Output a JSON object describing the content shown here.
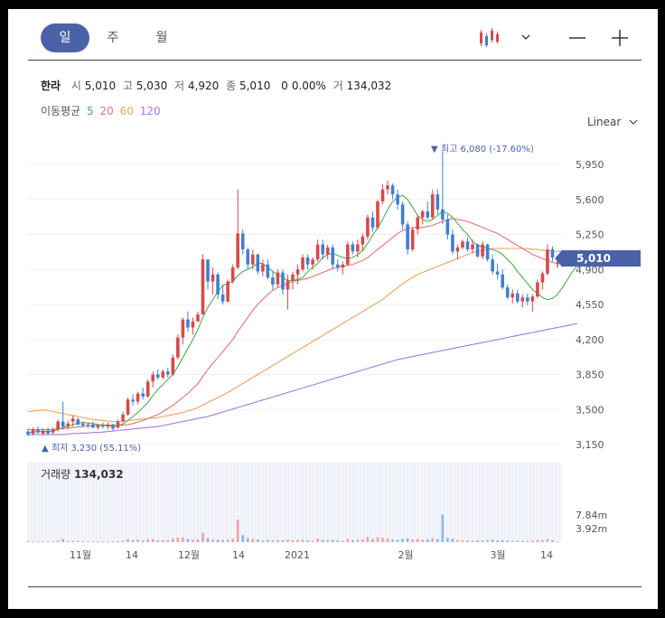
{
  "periods": [
    "일",
    "주",
    "월"
  ],
  "active_period": "일",
  "stock": {
    "name": "한라",
    "open_label": "시",
    "open": "5,010",
    "high_label": "고",
    "high": "5,030",
    "low_label": "저",
    "low": "4,920",
    "close_label": "종",
    "close": "5,010",
    "change": "0",
    "change_pct": "0.00%",
    "volume_label": "거",
    "volume": "134,032"
  },
  "ma": {
    "label": "이동평균",
    "periods": [
      {
        "value": "5",
        "color": "#4caf50"
      },
      {
        "value": "20",
        "color": "#e57373"
      },
      {
        "value": "60",
        "color": "#f0a15c"
      },
      {
        "value": "120",
        "color": "#a877e0"
      }
    ]
  },
  "scale_mode": "Linear",
  "annotations": {
    "high": "최고 6,080 (-17.60%)",
    "low": "최저 3,230 (55.11%)"
  },
  "current_price_tag": "5,010",
  "volume_panel": {
    "label": "거래량",
    "value": "134,032"
  },
  "chart_data": {
    "type": "candlestick",
    "price_axis": {
      "ticks": [
        "5,950",
        "5,600",
        "5,250",
        "4,900",
        "4,550",
        "4,200",
        "3,850",
        "3,500",
        "3,150"
      ],
      "range": [
        3150,
        6200
      ]
    },
    "volume_axis": {
      "ticks": [
        "7.84m",
        "3.92m"
      ],
      "range": [
        0,
        9000000
      ]
    },
    "x_ticks": [
      "11월",
      "14",
      "12월",
      "14",
      "2021",
      "2월",
      "3월",
      "14"
    ],
    "colors": {
      "up": "#d84a4a",
      "down": "#3f7fd4",
      "ma5": "#4caf50",
      "ma20": "#e57373",
      "ma60": "#f0a15c",
      "ma120": "#a877e0"
    },
    "candles": [
      {
        "o": 3280,
        "h": 3310,
        "l": 3230,
        "c": 3250,
        "v": 300000
      },
      {
        "o": 3260,
        "h": 3320,
        "l": 3240,
        "c": 3300,
        "v": 250000
      },
      {
        "o": 3300,
        "h": 3330,
        "l": 3260,
        "c": 3270,
        "v": 220000
      },
      {
        "o": 3260,
        "h": 3310,
        "l": 3240,
        "c": 3290,
        "v": 200000
      },
      {
        "o": 3290,
        "h": 3320,
        "l": 3250,
        "c": 3260,
        "v": 180000
      },
      {
        "o": 3270,
        "h": 3320,
        "l": 3250,
        "c": 3300,
        "v": 190000
      },
      {
        "o": 3300,
        "h": 3400,
        "l": 3280,
        "c": 3380,
        "v": 400000
      },
      {
        "o": 3380,
        "h": 3580,
        "l": 3300,
        "c": 3330,
        "v": 900000
      },
      {
        "o": 3330,
        "h": 3390,
        "l": 3300,
        "c": 3360,
        "v": 350000
      },
      {
        "o": 3380,
        "h": 3440,
        "l": 3330,
        "c": 3410,
        "v": 400000
      },
      {
        "o": 3400,
        "h": 3420,
        "l": 3340,
        "c": 3350,
        "v": 300000
      },
      {
        "o": 3360,
        "h": 3380,
        "l": 3320,
        "c": 3340,
        "v": 250000
      },
      {
        "o": 3340,
        "h": 3370,
        "l": 3310,
        "c": 3350,
        "v": 200000
      },
      {
        "o": 3350,
        "h": 3380,
        "l": 3310,
        "c": 3320,
        "v": 220000
      },
      {
        "o": 3320,
        "h": 3360,
        "l": 3300,
        "c": 3340,
        "v": 180000
      },
      {
        "o": 3340,
        "h": 3370,
        "l": 3310,
        "c": 3330,
        "v": 170000
      },
      {
        "o": 3330,
        "h": 3370,
        "l": 3300,
        "c": 3350,
        "v": 200000
      },
      {
        "o": 3350,
        "h": 3360,
        "l": 3290,
        "c": 3310,
        "v": 190000
      },
      {
        "o": 3320,
        "h": 3400,
        "l": 3310,
        "c": 3380,
        "v": 300000
      },
      {
        "o": 3380,
        "h": 3480,
        "l": 3370,
        "c": 3450,
        "v": 400000
      },
      {
        "o": 3450,
        "h": 3620,
        "l": 3440,
        "c": 3600,
        "v": 900000
      },
      {
        "o": 3600,
        "h": 3650,
        "l": 3540,
        "c": 3580,
        "v": 600000
      },
      {
        "o": 3580,
        "h": 3680,
        "l": 3550,
        "c": 3660,
        "v": 700000
      },
      {
        "o": 3660,
        "h": 3720,
        "l": 3600,
        "c": 3630,
        "v": 500000
      },
      {
        "o": 3630,
        "h": 3800,
        "l": 3620,
        "c": 3780,
        "v": 800000
      },
      {
        "o": 3780,
        "h": 3880,
        "l": 3720,
        "c": 3850,
        "v": 900000
      },
      {
        "o": 3850,
        "h": 3900,
        "l": 3800,
        "c": 3820,
        "v": 500000
      },
      {
        "o": 3820,
        "h": 3900,
        "l": 3800,
        "c": 3880,
        "v": 600000
      },
      {
        "o": 3880,
        "h": 3920,
        "l": 3820,
        "c": 3850,
        "v": 500000
      },
      {
        "o": 3850,
        "h": 4050,
        "l": 3840,
        "c": 4020,
        "v": 1100000
      },
      {
        "o": 4020,
        "h": 4250,
        "l": 4000,
        "c": 4220,
        "v": 1300000
      },
      {
        "o": 4220,
        "h": 4420,
        "l": 4150,
        "c": 4400,
        "v": 1400000
      },
      {
        "o": 4400,
        "h": 4480,
        "l": 4280,
        "c": 4320,
        "v": 900000
      },
      {
        "o": 4320,
        "h": 4420,
        "l": 4250,
        "c": 4380,
        "v": 700000
      },
      {
        "o": 4380,
        "h": 4480,
        "l": 4380,
        "c": 4450,
        "v": 800000
      },
      {
        "o": 4450,
        "h": 5050,
        "l": 4450,
        "c": 5000,
        "v": 2700000
      },
      {
        "o": 5000,
        "h": 5000,
        "l": 4700,
        "c": 4780,
        "v": 1200000
      },
      {
        "o": 4780,
        "h": 4920,
        "l": 4650,
        "c": 4850,
        "v": 800000
      },
      {
        "o": 4850,
        "h": 4870,
        "l": 4600,
        "c": 4650,
        "v": 700000
      },
      {
        "o": 4650,
        "h": 4750,
        "l": 4550,
        "c": 4580,
        "v": 600000
      },
      {
        "o": 4580,
        "h": 4800,
        "l": 4570,
        "c": 4780,
        "v": 700000
      },
      {
        "o": 4780,
        "h": 4950,
        "l": 4760,
        "c": 4920,
        "v": 900000
      },
      {
        "o": 4920,
        "h": 5700,
        "l": 4900,
        "c": 5260,
        "v": 6500000
      },
      {
        "o": 5260,
        "h": 5300,
        "l": 5050,
        "c": 5100,
        "v": 2000000
      },
      {
        "o": 5100,
        "h": 5120,
        "l": 4900,
        "c": 4950,
        "v": 1200000
      },
      {
        "o": 4950,
        "h": 5100,
        "l": 4900,
        "c": 5050,
        "v": 900000
      },
      {
        "o": 5050,
        "h": 5060,
        "l": 4850,
        "c": 4880,
        "v": 700000
      },
      {
        "o": 4880,
        "h": 5000,
        "l": 4830,
        "c": 4950,
        "v": 500000
      },
      {
        "o": 4950,
        "h": 5000,
        "l": 4800,
        "c": 4820,
        "v": 600000
      },
      {
        "o": 4820,
        "h": 4880,
        "l": 4700,
        "c": 4750,
        "v": 500000
      },
      {
        "o": 4750,
        "h": 4900,
        "l": 4720,
        "c": 4870,
        "v": 600000
      },
      {
        "o": 4870,
        "h": 4900,
        "l": 4650,
        "c": 4700,
        "v": 500000
      },
      {
        "o": 4700,
        "h": 4850,
        "l": 4500,
        "c": 4790,
        "v": 700000
      },
      {
        "o": 4790,
        "h": 4880,
        "l": 4700,
        "c": 4850,
        "v": 500000
      },
      {
        "o": 4850,
        "h": 4950,
        "l": 4750,
        "c": 4900,
        "v": 600000
      },
      {
        "o": 4900,
        "h": 5050,
        "l": 4880,
        "c": 5020,
        "v": 700000
      },
      {
        "o": 5020,
        "h": 5050,
        "l": 4900,
        "c": 4950,
        "v": 500000
      },
      {
        "o": 4950,
        "h": 5020,
        "l": 4900,
        "c": 5000,
        "v": 400000
      },
      {
        "o": 5000,
        "h": 5200,
        "l": 4980,
        "c": 5150,
        "v": 1000000
      },
      {
        "o": 5150,
        "h": 5200,
        "l": 5000,
        "c": 5050,
        "v": 700000
      },
      {
        "o": 5050,
        "h": 5150,
        "l": 5000,
        "c": 5120,
        "v": 600000
      },
      {
        "o": 5120,
        "h": 5150,
        "l": 4900,
        "c": 4950,
        "v": 700000
      },
      {
        "o": 4950,
        "h": 5000,
        "l": 4880,
        "c": 4920,
        "v": 500000
      },
      {
        "o": 4920,
        "h": 4980,
        "l": 4850,
        "c": 4950,
        "v": 400000
      },
      {
        "o": 4950,
        "h": 5180,
        "l": 4940,
        "c": 5150,
        "v": 900000
      },
      {
        "o": 5150,
        "h": 5180,
        "l": 5050,
        "c": 5080,
        "v": 600000
      },
      {
        "o": 5080,
        "h": 5200,
        "l": 5020,
        "c": 5150,
        "v": 700000
      },
      {
        "o": 5150,
        "h": 5260,
        "l": 5080,
        "c": 5230,
        "v": 800000
      },
      {
        "o": 5230,
        "h": 5450,
        "l": 5200,
        "c": 5420,
        "v": 1500000
      },
      {
        "o": 5420,
        "h": 5480,
        "l": 5280,
        "c": 5320,
        "v": 900000
      },
      {
        "o": 5320,
        "h": 5600,
        "l": 5300,
        "c": 5580,
        "v": 1400000
      },
      {
        "o": 5580,
        "h": 5750,
        "l": 5550,
        "c": 5700,
        "v": 1200000
      },
      {
        "o": 5700,
        "h": 5790,
        "l": 5650,
        "c": 5740,
        "v": 1000000
      },
      {
        "o": 5740,
        "h": 5760,
        "l": 5600,
        "c": 5650,
        "v": 800000
      },
      {
        "o": 5650,
        "h": 5700,
        "l": 5500,
        "c": 5550,
        "v": 700000
      },
      {
        "o": 5550,
        "h": 5580,
        "l": 5300,
        "c": 5350,
        "v": 900000
      },
      {
        "o": 5350,
        "h": 5380,
        "l": 5050,
        "c": 5100,
        "v": 1100000
      },
      {
        "o": 5100,
        "h": 5320,
        "l": 5080,
        "c": 5300,
        "v": 800000
      },
      {
        "o": 5300,
        "h": 5450,
        "l": 5250,
        "c": 5420,
        "v": 900000
      },
      {
        "o": 5420,
        "h": 5500,
        "l": 5350,
        "c": 5480,
        "v": 700000
      },
      {
        "o": 5480,
        "h": 5580,
        "l": 5400,
        "c": 5420,
        "v": 800000
      },
      {
        "o": 5420,
        "h": 5700,
        "l": 5400,
        "c": 5650,
        "v": 1200000
      },
      {
        "o": 5650,
        "h": 5700,
        "l": 5450,
        "c": 5500,
        "v": 900000
      },
      {
        "o": 5500,
        "h": 6080,
        "l": 5350,
        "c": 5400,
        "v": 8000000
      },
      {
        "o": 5400,
        "h": 5450,
        "l": 5200,
        "c": 5250,
        "v": 1200000
      },
      {
        "o": 5250,
        "h": 5300,
        "l": 5050,
        "c": 5080,
        "v": 1000000
      },
      {
        "o": 5080,
        "h": 5150,
        "l": 5000,
        "c": 5120,
        "v": 600000
      },
      {
        "o": 5120,
        "h": 5200,
        "l": 5100,
        "c": 5180,
        "v": 500000
      },
      {
        "o": 5180,
        "h": 5220,
        "l": 5080,
        "c": 5100,
        "v": 500000
      },
      {
        "o": 5100,
        "h": 5200,
        "l": 5060,
        "c": 5150,
        "v": 400000
      },
      {
        "o": 5150,
        "h": 5160,
        "l": 5020,
        "c": 5030,
        "v": 500000
      },
      {
        "o": 5030,
        "h": 5180,
        "l": 5000,
        "c": 5150,
        "v": 500000
      },
      {
        "o": 5150,
        "h": 5160,
        "l": 4980,
        "c": 5000,
        "v": 600000
      },
      {
        "o": 5000,
        "h": 5050,
        "l": 4850,
        "c": 4880,
        "v": 700000
      },
      {
        "o": 4880,
        "h": 4960,
        "l": 4800,
        "c": 4850,
        "v": 500000
      },
      {
        "o": 4850,
        "h": 4900,
        "l": 4700,
        "c": 4720,
        "v": 600000
      },
      {
        "o": 4720,
        "h": 4750,
        "l": 4600,
        "c": 4620,
        "v": 500000
      },
      {
        "o": 4620,
        "h": 4700,
        "l": 4560,
        "c": 4660,
        "v": 400000
      },
      {
        "o": 4660,
        "h": 4700,
        "l": 4560,
        "c": 4580,
        "v": 400000
      },
      {
        "o": 4580,
        "h": 4650,
        "l": 4520,
        "c": 4620,
        "v": 300000
      },
      {
        "o": 4620,
        "h": 4660,
        "l": 4540,
        "c": 4580,
        "v": 300000
      },
      {
        "o": 4580,
        "h": 4650,
        "l": 4480,
        "c": 4630,
        "v": 400000
      },
      {
        "o": 4630,
        "h": 4800,
        "l": 4610,
        "c": 4770,
        "v": 600000
      },
      {
        "o": 4770,
        "h": 4880,
        "l": 4700,
        "c": 4860,
        "v": 600000
      },
      {
        "o": 4860,
        "h": 5150,
        "l": 4840,
        "c": 5100,
        "v": 900000
      },
      {
        "o": 5100,
        "h": 5130,
        "l": 4980,
        "c": 5020,
        "v": 600000
      },
      {
        "o": 5010,
        "h": 5030,
        "l": 4920,
        "c": 5010,
        "v": 134032
      }
    ],
    "ma5": [
      3270,
      3275,
      3280,
      3280,
      3280,
      3285,
      3300,
      3320,
      3335,
      3350,
      3365,
      3370,
      3365,
      3360,
      3350,
      3345,
      3340,
      3330,
      3340,
      3355,
      3390,
      3430,
      3470,
      3520,
      3570,
      3640,
      3700,
      3750,
      3800,
      3850,
      3930,
      4020,
      4110,
      4200,
      4300,
      4420,
      4520,
      4600,
      4680,
      4740,
      4760,
      4780,
      4840,
      4880,
      4900,
      4930,
      4960,
      4960,
      4920,
      4880,
      4850,
      4820,
      4790,
      4790,
      4800,
      4820,
      4880,
      4920,
      4960,
      5020,
      5050,
      5060,
      5040,
      5020,
      5010,
      5020,
      5050,
      5090,
      5160,
      5240,
      5320,
      5400,
      5500,
      5580,
      5620,
      5640,
      5600,
      5520,
      5440,
      5400,
      5380,
      5400,
      5440,
      5480,
      5460,
      5420,
      5360,
      5300,
      5250,
      5180,
      5140,
      5130,
      5110,
      5100,
      5080,
      5050,
      5000,
      4950,
      4880,
      4820,
      4760,
      4700,
      4660,
      4620,
      4600,
      4610,
      4650,
      4720,
      4800,
      4880,
      4940
    ],
    "ma20": [
      3300,
      3300,
      3300,
      3300,
      3300,
      3300,
      3305,
      3310,
      3315,
      3320,
      3325,
      3330,
      3335,
      3340,
      3340,
      3345,
      3345,
      3340,
      3340,
      3345,
      3350,
      3360,
      3375,
      3390,
      3410,
      3430,
      3450,
      3480,
      3510,
      3540,
      3580,
      3620,
      3660,
      3710,
      3760,
      3830,
      3900,
      3960,
      4020,
      4080,
      4140,
      4200,
      4280,
      4350,
      4420,
      4490,
      4550,
      4600,
      4650,
      4690,
      4720,
      4740,
      4760,
      4780,
      4790,
      4800,
      4810,
      4830,
      4850,
      4870,
      4890,
      4910,
      4920,
      4930,
      4940,
      4950,
      4970,
      4990,
      5020,
      5060,
      5100,
      5140,
      5180,
      5220,
      5260,
      5290,
      5310,
      5320,
      5320,
      5320,
      5330,
      5340,
      5360,
      5380,
      5400,
      5410,
      5400,
      5390,
      5380,
      5360,
      5340,
      5320,
      5300,
      5280,
      5260,
      5230,
      5200,
      5170,
      5140,
      5110,
      5080,
      5050,
      5030,
      5010,
      4990,
      4970,
      4960,
      4950,
      4950,
      4960,
      4970
    ],
    "ma60": [
      3480,
      3485,
      3490,
      3495,
      3490,
      3480,
      3470,
      3460,
      3450,
      3440,
      3430,
      3420,
      3410,
      3400,
      3395,
      3390,
      3385,
      3380,
      3380,
      3385,
      3390,
      3395,
      3400,
      3405,
      3410,
      3415,
      3420,
      3430,
      3440,
      3450,
      3460,
      3470,
      3485,
      3500,
      3520,
      3545,
      3570,
      3595,
      3620,
      3645,
      3670,
      3700,
      3730,
      3760,
      3790,
      3820,
      3850,
      3880,
      3910,
      3940,
      3970,
      4000,
      4030,
      4060,
      4090,
      4120,
      4150,
      4180,
      4210,
      4240,
      4270,
      4300,
      4330,
      4360,
      4390,
      4420,
      4450,
      4480,
      4510,
      4540,
      4570,
      4600,
      4640,
      4680,
      4720,
      4760,
      4790,
      4820,
      4850,
      4870,
      4890,
      4910,
      4930,
      4950,
      4970,
      4990,
      5010,
      5030,
      5050,
      5070,
      5080,
      5090,
      5100,
      5110,
      5110,
      5110,
      5110,
      5110,
      5110,
      5110,
      5110,
      5100,
      5100,
      5090,
      5090,
      5080,
      5080,
      5080,
      5080,
      5080,
      5080
    ],
    "ma120": [
      3250,
      3250,
      3250,
      3250,
      3250,
      3250,
      3250,
      3250,
      3255,
      3260,
      3260,
      3265,
      3265,
      3270,
      3270,
      3275,
      3280,
      3285,
      3290,
      3295,
      3300,
      3305,
      3310,
      3315,
      3320,
      3325,
      3330,
      3340,
      3350,
      3360,
      3370,
      3380,
      3390,
      3400,
      3410,
      3420,
      3430,
      3445,
      3460,
      3475,
      3490,
      3505,
      3520,
      3535,
      3550,
      3565,
      3580,
      3595,
      3610,
      3625,
      3640,
      3655,
      3670,
      3685,
      3700,
      3715,
      3730,
      3745,
      3760,
      3775,
      3790,
      3805,
      3820,
      3835,
      3850,
      3865,
      3880,
      3895,
      3910,
      3925,
      3940,
      3955,
      3970,
      3985,
      4000,
      4010,
      4020,
      4030,
      4040,
      4050,
      4060,
      4070,
      4080,
      4090,
      4100,
      4110,
      4120,
      4130,
      4140,
      4150,
      4160,
      4170,
      4180,
      4190,
      4200,
      4210,
      4220,
      4230,
      4240,
      4250,
      4260,
      4270,
      4280,
      4290,
      4300,
      4310,
      4320,
      4330,
      4340,
      4350,
      4360
    ]
  }
}
